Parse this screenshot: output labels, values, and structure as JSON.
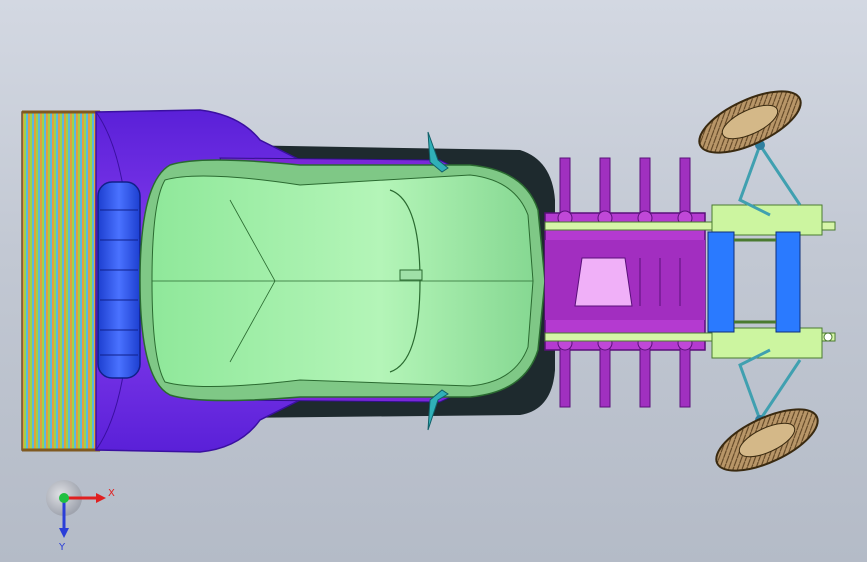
{
  "scene": {
    "description_name": "cad-model-viewport",
    "colors": {
      "background_top": "#d3d8e2",
      "background_bottom": "#b4bbc7",
      "body_purple": "#7b32e6",
      "cabin_green": "#9ff0a8",
      "engine_magenta": "#b43ad0",
      "frame_green": "#ccf5a0",
      "radiator_blue": "#3366ff",
      "wheel_tan": "#b89668",
      "spoiler_stripes": [
        "#9fd24a",
        "#59b9e0",
        "#e0a040"
      ]
    }
  },
  "triad": {
    "x_label": "X",
    "y_label": "Y",
    "x_color": "#e02020",
    "y_color": "#2a3ed8",
    "origin_color": "#20c040"
  }
}
